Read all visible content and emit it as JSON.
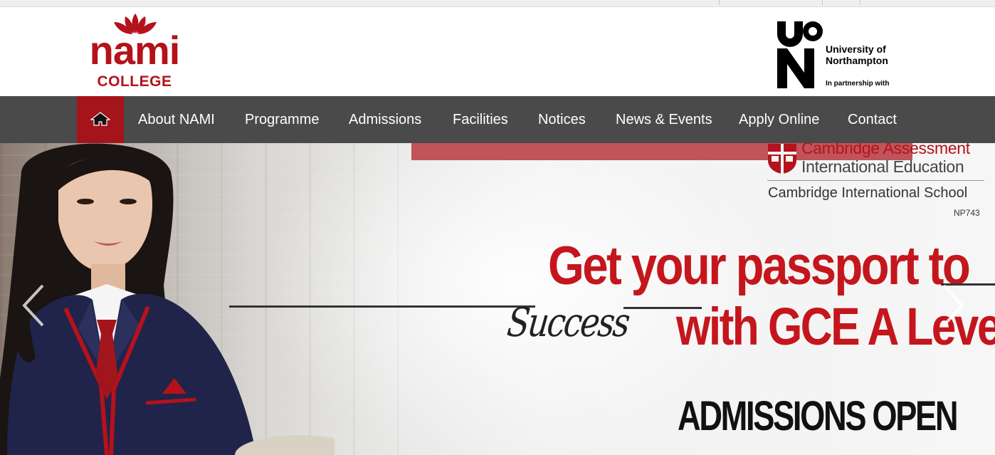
{
  "colors": {
    "brand_red": "#b5121b",
    "nav_background": "#4a4a4a",
    "home_button": "#a5141b",
    "headline_red": "#c4161c"
  },
  "header": {
    "nami_logo": {
      "icon": "lotus-icon",
      "wordmark": "nami",
      "sub": "COLLEGE"
    },
    "uon_logo": {
      "mark": "UON",
      "name_line1": "University of",
      "name_line2": "Northampton",
      "tagline": "In partnership with"
    }
  },
  "nav": {
    "home_icon": "home-icon",
    "items": [
      "About NAMI",
      "Programme",
      "Admissions",
      "Facilities",
      "Notices",
      "News & Events",
      "Apply Online",
      "Contact"
    ]
  },
  "hero": {
    "cambridge": {
      "line1": "Cambridge Assessment",
      "line2": "International Education",
      "school": "Cambridge International School",
      "code": "NP743"
    },
    "headline_line1": "Get your passport to",
    "headline_script": "Success",
    "headline_line2": "with GCE A Level",
    "admissions": "ADMISSIONS OPEN",
    "prev_icon": "chevron-left-icon",
    "next_icon": "chevron-right-icon"
  }
}
